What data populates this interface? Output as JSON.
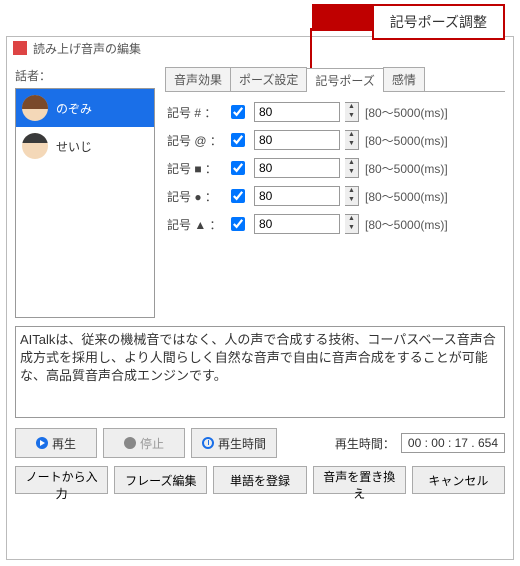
{
  "callout": {
    "label": "記号ポーズ調整"
  },
  "window": {
    "title": "読み上げ音声の編集"
  },
  "speaker": {
    "label": "話者：",
    "items": [
      {
        "name": "のぞみ",
        "selected": true
      },
      {
        "name": "せいじ",
        "selected": false
      }
    ]
  },
  "tabs": {
    "items": [
      {
        "label": "音声効果"
      },
      {
        "label": "ポーズ設定"
      },
      {
        "label": "記号ポーズ",
        "active": true
      },
      {
        "label": "感情"
      }
    ]
  },
  "params": {
    "rows": [
      {
        "label": "記号 # ：",
        "checked": true,
        "value": "80",
        "range": "[80～5000(ms)]"
      },
      {
        "label": "記号 @ ：",
        "checked": true,
        "value": "80",
        "range": "[80～5000(ms)]"
      },
      {
        "label": "記号 ■ ：",
        "checked": true,
        "value": "80",
        "range": "[80～5000(ms)]"
      },
      {
        "label": "記号 ● ：",
        "checked": true,
        "value": "80",
        "range": "[80～5000(ms)]"
      },
      {
        "label": "記号 ▲ ：",
        "checked": true,
        "value": "80",
        "range": "[80～5000(ms)]"
      }
    ]
  },
  "text_content": "AITalkは、従来の機械音ではなく、人の声で合成する技術、コーパスベース音声合成方式を採用し、より人間らしく自然な音声で自由に音声合成をすることが可能な、高品質音声合成エンジンです。",
  "playbar": {
    "play": "再生",
    "stop": "停止",
    "playtime_btn": "再生時間",
    "playtime_label": "再生時間：",
    "time_value": "00 : 00 : 17 . 654"
  },
  "bottom": {
    "from_note": "ノートから入力",
    "phrase_edit": "フレーズ編集",
    "register_word": "単語を登録",
    "replace_voice": "音声を置き換え",
    "cancel": "キャンセル"
  }
}
